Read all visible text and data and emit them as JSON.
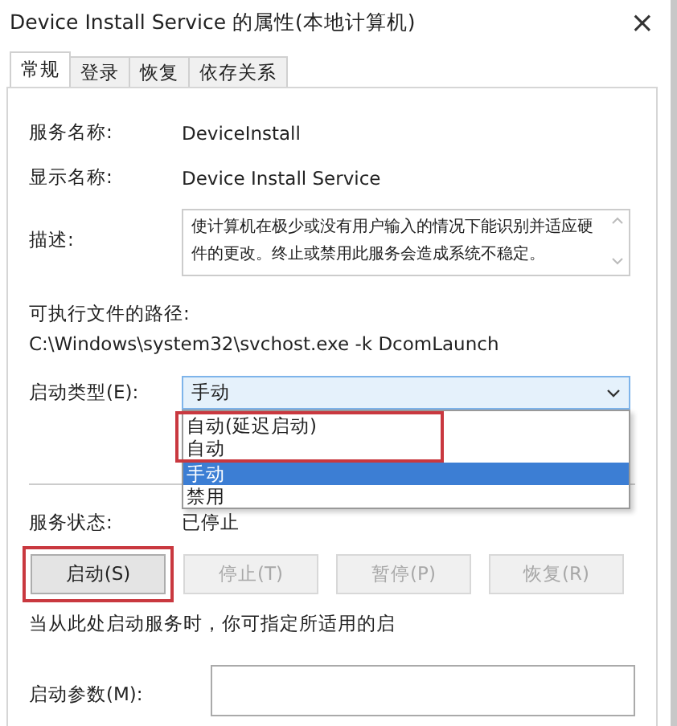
{
  "window": {
    "title": "Device Install Service 的属性(本地计算机)",
    "close": "×"
  },
  "tabs": [
    {
      "label": "常规",
      "selected": true
    },
    {
      "label": "登录",
      "selected": false
    },
    {
      "label": "恢复",
      "selected": false
    },
    {
      "label": "依存关系",
      "selected": false
    }
  ],
  "fields": [
    {
      "label": "服务名称:",
      "value": "DeviceInstall"
    },
    {
      "label": "显示名称:",
      "value": "Device Install Service"
    }
  ],
  "description": {
    "label": "描述:",
    "text": "使计算机在极少或没有用户输入的情况下能识别并适应硬件的更改。终止或禁用此服务会造成系统不稳定。"
  },
  "path": {
    "label": "可执行文件的路径:",
    "value": "C:\\Windows\\system32\\svchost.exe -k DcomLaunch"
  },
  "startup_type": {
    "label": "启动类型(E):",
    "value": "手动",
    "options": [
      {
        "label": "自动(延迟启动)",
        "selected": false,
        "highlighted": true
      },
      {
        "label": "自动",
        "selected": false,
        "highlighted": true
      },
      {
        "label": "手动",
        "selected": true,
        "highlighted": false
      },
      {
        "label": "禁用",
        "selected": false,
        "highlighted": false
      }
    ]
  },
  "status": {
    "label": "服务状态:",
    "value": "已停止"
  },
  "buttons": [
    {
      "label": "启动(S)",
      "disabled": false,
      "highlighted": true
    },
    {
      "label": "停止(T)",
      "disabled": true,
      "highlighted": false
    },
    {
      "label": "暂停(P)",
      "disabled": true,
      "highlighted": false
    },
    {
      "label": "恢复(R)",
      "disabled": true,
      "highlighted": false
    }
  ],
  "hint": "当从此处启动服务时，你可指定所适用的启",
  "parameters": {
    "label": "启动参数(M):"
  }
}
